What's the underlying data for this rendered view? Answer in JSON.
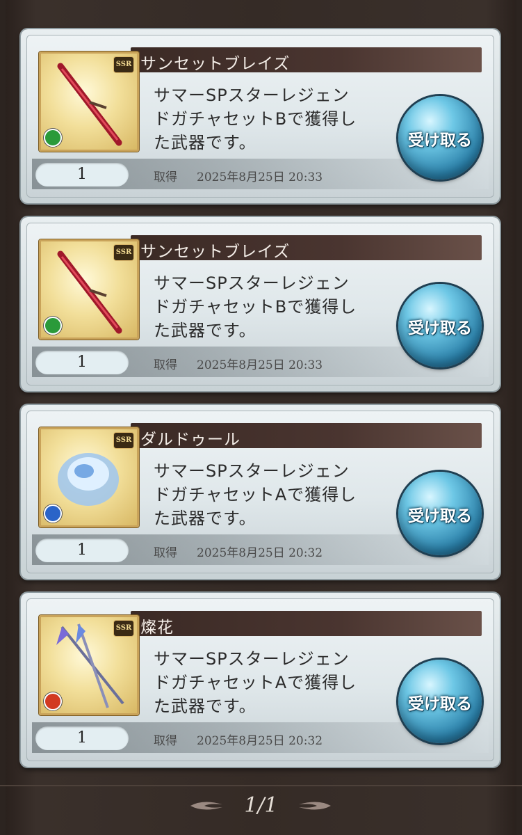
{
  "items": [
    {
      "name": "サンセットブレイズ",
      "description_lines": [
        "サマーSPスターレジェン",
        "ドガチャセットBで獲得し",
        "た武器です。"
      ],
      "quantity": "1",
      "acquired_label": "取得",
      "acquired_at": "2025年8月25日 20:33",
      "rarity": "SSR",
      "element": "wind",
      "element_color": "#2a9a3a",
      "weapon_icon": "red-sword-icon",
      "receive_label": "受け取る"
    },
    {
      "name": "サンセットブレイズ",
      "description_lines": [
        "サマーSPスターレジェン",
        "ドガチャセットBで獲得し",
        "た武器です。"
      ],
      "quantity": "1",
      "acquired_label": "取得",
      "acquired_at": "2025年8月25日 20:33",
      "rarity": "SSR",
      "element": "wind",
      "element_color": "#2a9a3a",
      "weapon_icon": "red-sword-icon",
      "receive_label": "受け取る"
    },
    {
      "name": "ダルドゥール",
      "description_lines": [
        "サマーSPスターレジェン",
        "ドガチャセットAで獲得し",
        "た武器です。"
      ],
      "quantity": "1",
      "acquired_label": "取得",
      "acquired_at": "2025年8月25日 20:32",
      "rarity": "SSR",
      "element": "water",
      "element_color": "#2a64c8",
      "weapon_icon": "water-orb-icon",
      "receive_label": "受け取る"
    },
    {
      "name": "燦花",
      "description_lines": [
        "サマーSPスターレジェン",
        "ドガチャセットAで獲得し",
        "た武器です。"
      ],
      "quantity": "1",
      "acquired_label": "取得",
      "acquired_at": "2025年8月25日 20:32",
      "rarity": "SSR",
      "element": "fire",
      "element_color": "#d23a22",
      "weapon_icon": "twin-spear-icon",
      "receive_label": "受け取る"
    }
  ],
  "pagination": {
    "label": "1/1"
  }
}
